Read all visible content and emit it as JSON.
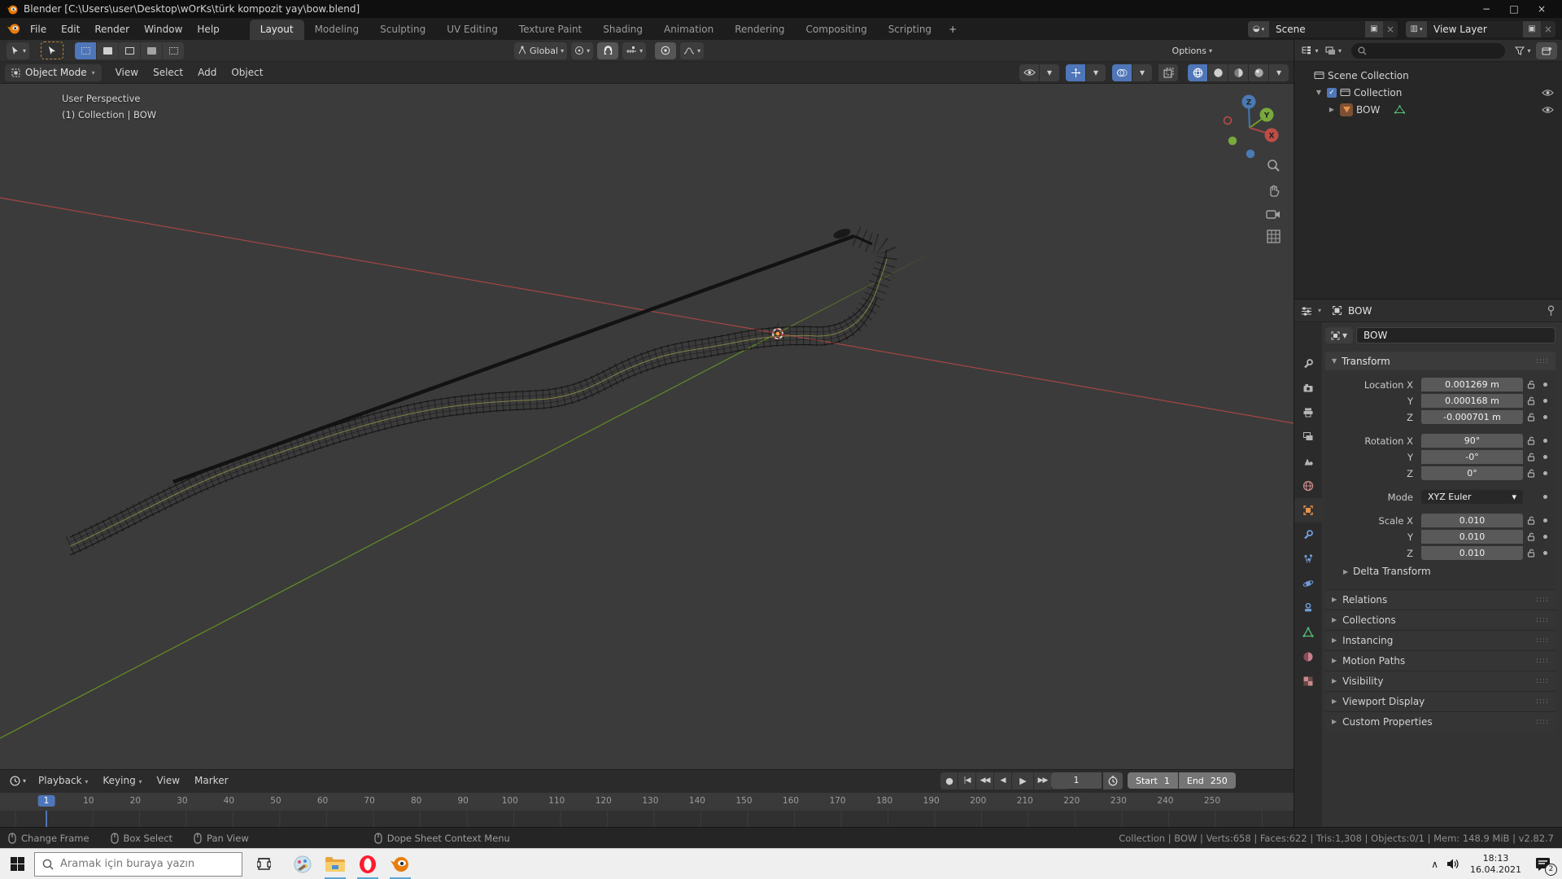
{
  "colors": {
    "accent": "#4f76b8",
    "object_orange": "#e8924a",
    "axis_x": "#a84545",
    "axis_y": "#6fa21c",
    "axis_z": "#3f79b5"
  },
  "titlebar": {
    "title": "Blender [C:\\Users\\user\\Desktop\\wOrKs\\türk kompozit yay\\bow.blend]"
  },
  "topbar": {
    "menus": [
      "File",
      "Edit",
      "Render",
      "Window",
      "Help"
    ],
    "tabs": [
      "Layout",
      "Modeling",
      "Sculpting",
      "UV Editing",
      "Texture Paint",
      "Shading",
      "Animation",
      "Rendering",
      "Compositing",
      "Scripting"
    ],
    "active_tab": "Layout",
    "new_tab_label": "+",
    "scene_label": "Scene",
    "view_layer_label": "View Layer"
  },
  "toolbar": {
    "orientation_label": "Global",
    "options_label": "Options"
  },
  "viewport_header": {
    "mode_label": "Object Mode",
    "menus": [
      "View",
      "Select",
      "Add",
      "Object"
    ]
  },
  "viewport": {
    "overlay_title": "User Perspective",
    "overlay_subtitle": "(1) Collection | BOW",
    "axis_labels": {
      "x": "X",
      "y": "Y",
      "z": "Z"
    }
  },
  "outliner": {
    "tree": [
      {
        "label": "Scene Collection",
        "type": "collection",
        "indent": 0,
        "expander": "",
        "checkbox": false,
        "eye": false,
        "data_icon": false
      },
      {
        "label": "Collection",
        "type": "collection",
        "indent": 1,
        "expander": "▼",
        "checkbox": true,
        "eye": true,
        "data_icon": false
      },
      {
        "label": "BOW",
        "type": "mesh",
        "indent": 2,
        "expander": "▶",
        "checkbox": false,
        "eye": true,
        "data_icon": true
      }
    ]
  },
  "properties": {
    "breadcrumb": "BOW",
    "name_value": "BOW",
    "tabs": [
      "tool",
      "render",
      "output",
      "view-layer",
      "scene",
      "world",
      "object",
      "modifiers",
      "particles",
      "physics",
      "constraints",
      "object-data",
      "material",
      "texture"
    ],
    "active_tab": "object",
    "transform_title": "Transform",
    "groups": [
      {
        "rows": [
          {
            "label": "Location X",
            "value": "0.001269 m",
            "lock": true
          },
          {
            "label": "Y",
            "value": "0.000168 m",
            "lock": true
          },
          {
            "label": "Z",
            "value": "-0.000701 m",
            "lock": true
          }
        ]
      },
      {
        "rows": [
          {
            "label": "Rotation X",
            "value": "90°",
            "lock": true
          },
          {
            "label": "Y",
            "value": "-0°",
            "lock": true
          },
          {
            "label": "Z",
            "value": "0°",
            "lock": true
          }
        ]
      },
      {
        "rows": [
          {
            "label": "Mode",
            "value": "XYZ Euler",
            "dropdown": true
          }
        ]
      },
      {
        "rows": [
          {
            "label": "Scale X",
            "value": "0.010",
            "lock": true
          },
          {
            "label": "Y",
            "value": "0.010",
            "lock": true
          },
          {
            "label": "Z",
            "value": "0.010",
            "lock": true
          }
        ]
      }
    ],
    "sub_panels": [
      "Delta Transform"
    ],
    "collapsed_panels": [
      "Relations",
      "Collections",
      "Instancing",
      "Motion Paths",
      "Visibility",
      "Viewport Display",
      "Custom Properties"
    ]
  },
  "timeline": {
    "menus": [
      "Playback",
      "Keying",
      "View",
      "Marker"
    ],
    "current_frame": "1",
    "ticks": [
      10,
      20,
      30,
      40,
      50,
      60,
      70,
      80,
      90,
      100,
      110,
      120,
      130,
      140,
      150,
      160,
      170,
      180,
      190,
      200,
      210,
      220,
      230,
      240,
      250
    ],
    "frame_field": "1",
    "start_label": "Start",
    "start_value": "1",
    "end_label": "End",
    "end_value": "250"
  },
  "statusbar": {
    "hints": [
      "Change Frame",
      "Box Select",
      "Pan View",
      "Dope Sheet Context Menu"
    ],
    "info": "Collection | BOW | Verts:658 | Faces:622 | Tris:1,308 | Objects:0/1 | Mem: 148.9 MiB | v2.82.7"
  },
  "taskbar": {
    "search_placeholder": "Aramak için buraya yazın",
    "time": "18:13",
    "date": "16.04.2021",
    "badge": "2"
  }
}
